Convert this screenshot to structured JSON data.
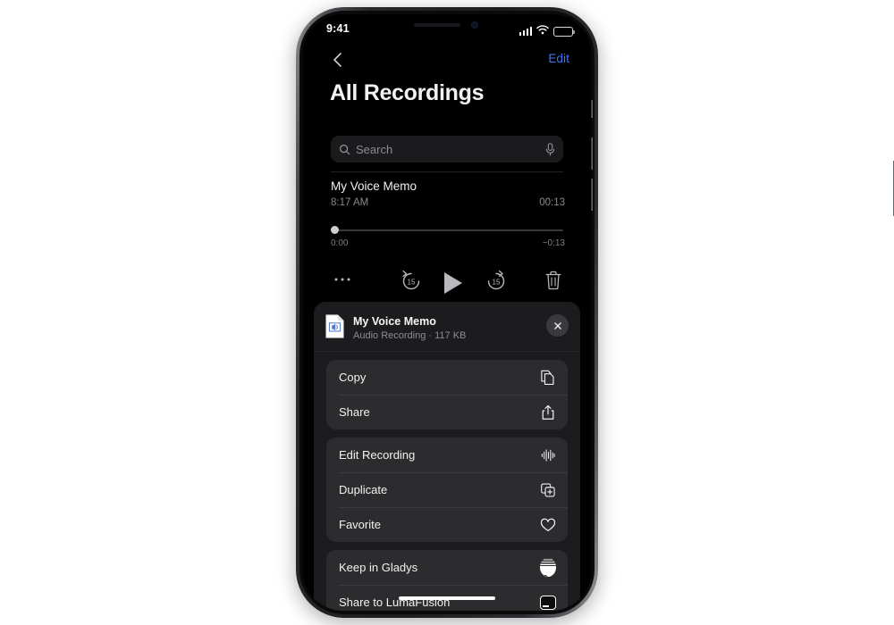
{
  "status_bar": {
    "time": "9:41",
    "signal_icon": "cellular-signal-icon",
    "wifi_icon": "wifi-icon",
    "battery_icon": "battery-icon"
  },
  "nav": {
    "back_icon": "chevron-left-icon",
    "edit_label": "Edit",
    "edit_color": "#3b74f2"
  },
  "page": {
    "title": "All Recordings"
  },
  "search": {
    "placeholder": "Search",
    "value": "",
    "search_icon": "search-icon",
    "mic_icon": "microphone-icon"
  },
  "recording": {
    "title": "My Voice Memo",
    "time": "8:17 AM",
    "duration": "00:13",
    "elapsed": "0:00",
    "remaining": "−0:13",
    "progress_percent": 0
  },
  "controls": [
    {
      "name": "more-options-button",
      "icon": "ellipsis-icon",
      "label": "More"
    },
    {
      "name": "skip-back-button",
      "icon": "skip-back-15-icon",
      "label": "15"
    },
    {
      "name": "play-button",
      "icon": "play-icon",
      "label": "Play"
    },
    {
      "name": "skip-forward-button",
      "icon": "skip-forward-15-icon",
      "label": "15"
    },
    {
      "name": "delete-button",
      "icon": "trash-icon",
      "label": "Delete"
    }
  ],
  "share_sheet": {
    "file_name": "My Voice Memo",
    "file_meta": "Audio Recording · 117 KB",
    "file_icon": "audio-document-icon",
    "close_icon": "close-icon",
    "groups": [
      {
        "rows": [
          {
            "label": "Copy",
            "icon": "copy-icon"
          },
          {
            "label": "Share",
            "icon": "share-icon"
          }
        ]
      },
      {
        "rows": [
          {
            "label": "Edit Recording",
            "icon": "waveform-icon"
          },
          {
            "label": "Duplicate",
            "icon": "duplicate-icon"
          },
          {
            "label": "Favorite",
            "icon": "heart-icon"
          }
        ]
      },
      {
        "rows": [
          {
            "label": "Keep in Gladys",
            "icon": "gladys-app-icon"
          },
          {
            "label": "Share to LumaFusion",
            "icon": "lumafusion-app-icon"
          }
        ]
      }
    ]
  },
  "home_indicator": "home-indicator"
}
